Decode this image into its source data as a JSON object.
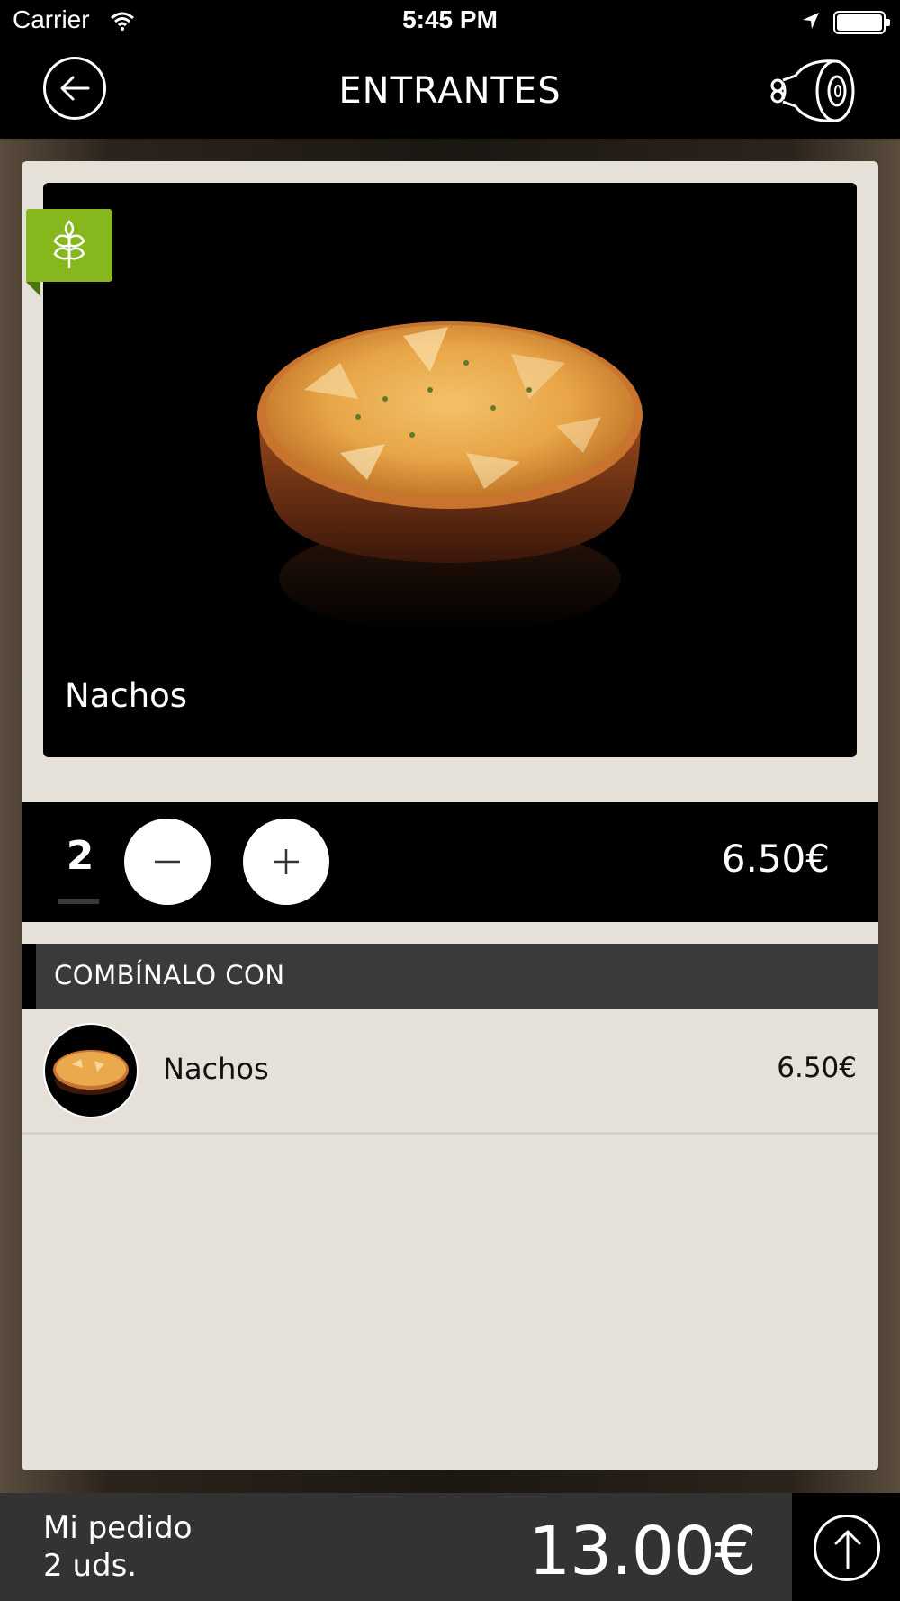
{
  "status_bar": {
    "carrier": "Carrier",
    "time": "5:45 PM"
  },
  "nav": {
    "title": "ENTRANTES",
    "back_icon": "arrow-left-circle-icon",
    "category_icon": "ham-leg-icon"
  },
  "product": {
    "name": "Nachos",
    "badge_icon": "wheat-gluten-icon",
    "badge_color": "#86b81e"
  },
  "quantity_bar": {
    "quantity": "2",
    "unit_price": "6.50€"
  },
  "combine": {
    "title": "COMBÍNALO CON",
    "items": [
      {
        "name": "Nachos",
        "price": "6.50€"
      }
    ]
  },
  "footer": {
    "label": "Mi pedido",
    "units": "2 uds.",
    "total": "13.00€"
  }
}
